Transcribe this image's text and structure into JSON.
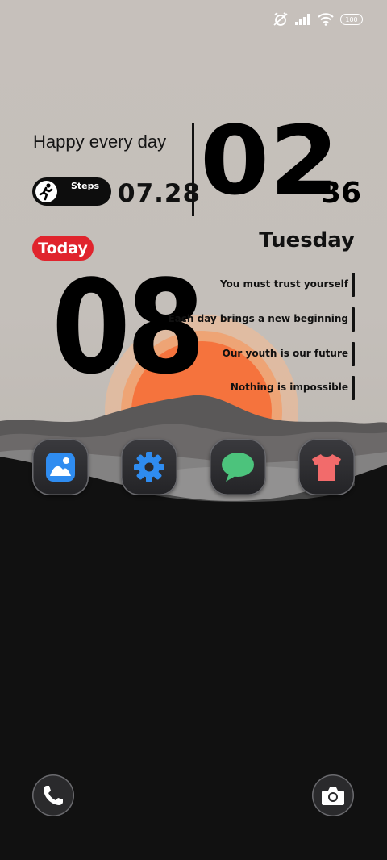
{
  "status_bar": {
    "icons": [
      "alarm-off-icon",
      "signal-icon",
      "wifi-icon"
    ],
    "battery": "100"
  },
  "widget": {
    "greeting": "Happy every day",
    "steps_label": "Steps",
    "date": "07.28",
    "hour": "02",
    "minute": "36",
    "weekday": "Tuesday",
    "today_label": "Today",
    "day_number": "08",
    "quotes": [
      "You must trust yourself",
      "Each day brings a new beginning",
      "Our youth is our future",
      "Nothing is impossible"
    ]
  },
  "apps": [
    {
      "icon": "gallery-icon"
    },
    {
      "icon": "settings-gear-icon"
    },
    {
      "icon": "messages-icon"
    },
    {
      "icon": "themes-shirt-icon"
    }
  ],
  "dock": [
    {
      "icon": "phone-icon"
    },
    {
      "icon": "camera-icon"
    }
  ],
  "colors": {
    "sun": "#f5733d",
    "today_pill": "#e0242d",
    "background": "#111111"
  }
}
